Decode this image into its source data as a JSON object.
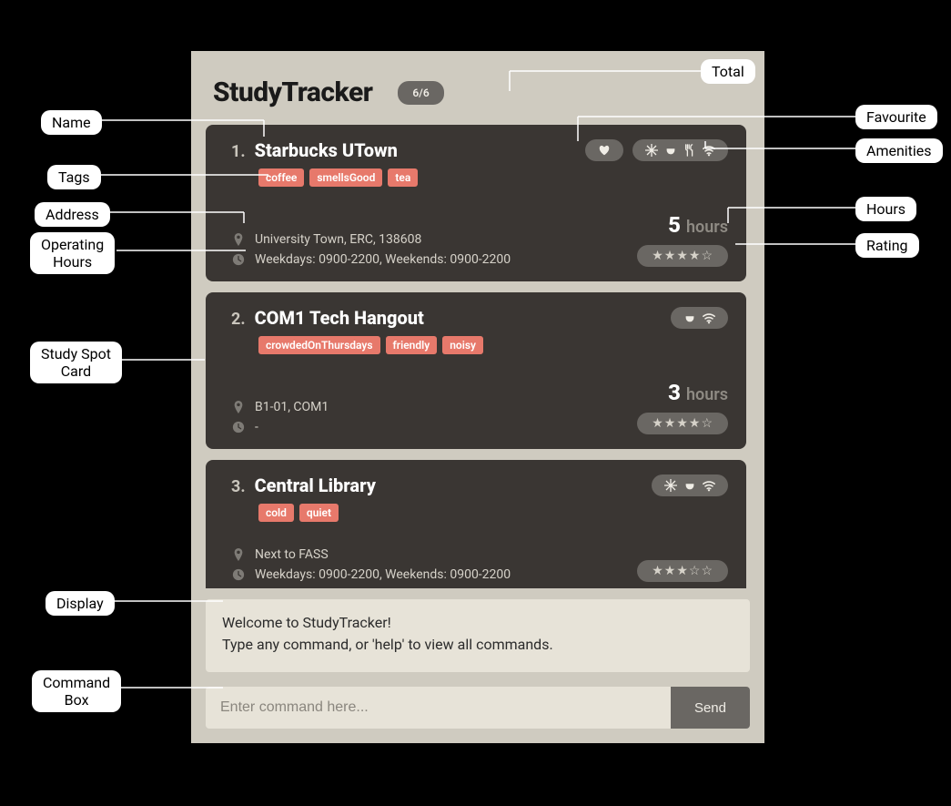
{
  "app": {
    "title": "StudyTracker",
    "total_badge": "6/6"
  },
  "cards": [
    {
      "index": "1.",
      "name": "Starbucks UTown",
      "favourite": true,
      "amenities": [
        "aircon",
        "charger",
        "food",
        "wifi"
      ],
      "tags": [
        "coffee",
        "smellsGood",
        "tea"
      ],
      "address": "University Town, ERC, 138608",
      "hours_text": "Weekdays: 0900-2200, Weekends: 0900-2200",
      "study_hours_num": "5",
      "study_hours_label": "hours",
      "rating_filled": 4,
      "rating_total": 5
    },
    {
      "index": "2.",
      "name": "COM1 Tech Hangout",
      "favourite": false,
      "amenities": [
        "charger",
        "wifi"
      ],
      "tags": [
        "crowdedOnThursdays",
        "friendly",
        "noisy"
      ],
      "address": "B1-01, COM1",
      "hours_text": "-",
      "study_hours_num": "3",
      "study_hours_label": "hours",
      "rating_filled": 4,
      "rating_total": 5
    },
    {
      "index": "3.",
      "name": "Central Library",
      "favourite": false,
      "amenities": [
        "aircon",
        "charger",
        "wifi"
      ],
      "tags": [
        "cold",
        "quiet"
      ],
      "address": "Next to FASS",
      "hours_text": "Weekdays: 0900-2200, Weekends: 0900-2200",
      "study_hours_num": "",
      "study_hours_label": "",
      "rating_filled": 3,
      "rating_total": 5
    }
  ],
  "display": {
    "line1": "Welcome to StudyTracker!",
    "line2": "Type any command, or 'help' to view all commands."
  },
  "command": {
    "placeholder": "Enter command here...",
    "send_label": "Send"
  },
  "callouts": {
    "total": "Total",
    "favourite": "Favourite",
    "amenities": "Amenities",
    "hours": "Hours",
    "rating": "Rating",
    "name": "Name",
    "tags": "Tags",
    "address": "Address",
    "op_hours": "Operating\nHours",
    "study_card": "Study Spot\nCard",
    "display": "Display",
    "cmd_box": "Command\nBox"
  },
  "icons": {
    "heart": "heart-icon",
    "aircon": "snowflake-icon",
    "charger": "plug-icon",
    "food": "utensils-icon",
    "wifi": "wifi-icon",
    "pin": "pin-icon",
    "clock": "clock-icon"
  },
  "colors": {
    "tag_bg": "#e7796b",
    "card_bg": "#3a3633",
    "panel_bg": "#cfcbc0",
    "pill_bg": "#6a6763"
  }
}
